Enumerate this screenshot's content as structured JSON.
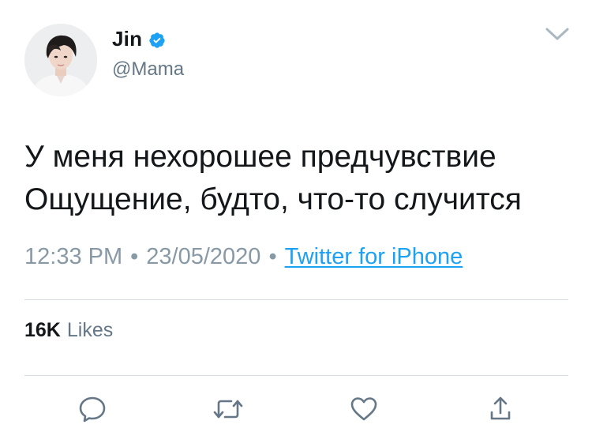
{
  "user": {
    "display_name": "Jin",
    "handle": "@Mama",
    "verified": true,
    "avatar_icon": "profile-photo"
  },
  "tweet": {
    "text": "У меня нехорошее предчувствие\nОщущение, будто, что-то случится",
    "time": "12:33 PM",
    "date": "23/05/2020",
    "separator": "•",
    "source": "Twitter for iPhone"
  },
  "stats": {
    "likes_count": "16K",
    "likes_label": "Likes"
  },
  "actions": {
    "reply_icon": "reply-icon",
    "retweet_icon": "retweet-icon",
    "like_icon": "heart-icon",
    "share_icon": "share-icon"
  },
  "colors": {
    "text": "#14171a",
    "secondary": "#657786",
    "meta": "#8899a6",
    "link": "#1da1f2",
    "verified": "#1da1f2",
    "icon": "#657786",
    "divider": "#d5dbe0"
  }
}
